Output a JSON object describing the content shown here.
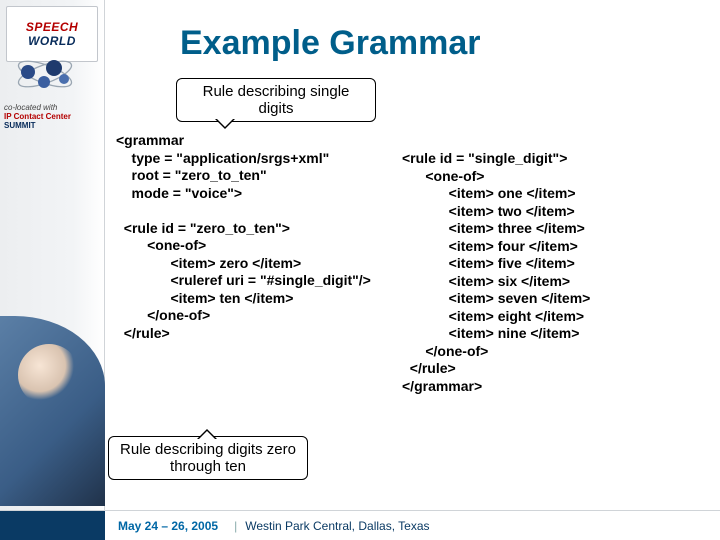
{
  "logo": {
    "line1": "SPEECH",
    "line2": "WORLD"
  },
  "partner": {
    "label": "co-located with",
    "brand1": "IP Contact Center",
    "brand2": "SUMMIT"
  },
  "title": "Example Grammar",
  "callouts": {
    "top": "Rule describing single digits",
    "bottom": "Rule describing digits zero through ten"
  },
  "code": {
    "left": "<grammar\n    type = \"application/srgs+xml\"\n    root = \"zero_to_ten\"\n    mode = \"voice\">\n\n  <rule id = \"zero_to_ten\">\n        <one-of>\n              <item> zero </item>\n              <ruleref uri = \"#single_digit\"/>\n              <item> ten </item>\n        </one-of>\n  </rule>",
    "right": "<rule id = \"single_digit\">\n      <one-of>\n            <item> one </item>\n            <item> two </item>\n            <item> three </item>\n            <item> four </item>\n            <item> five </item>\n            <item> six </item>\n            <item> seven </item>\n            <item> eight </item>\n            <item> nine </item>\n      </one-of>\n  </rule>\n</grammar>"
  },
  "footer": {
    "dates": "May 24 – 26, 2005",
    "venue": "Westin Park Central, Dallas, Texas"
  }
}
